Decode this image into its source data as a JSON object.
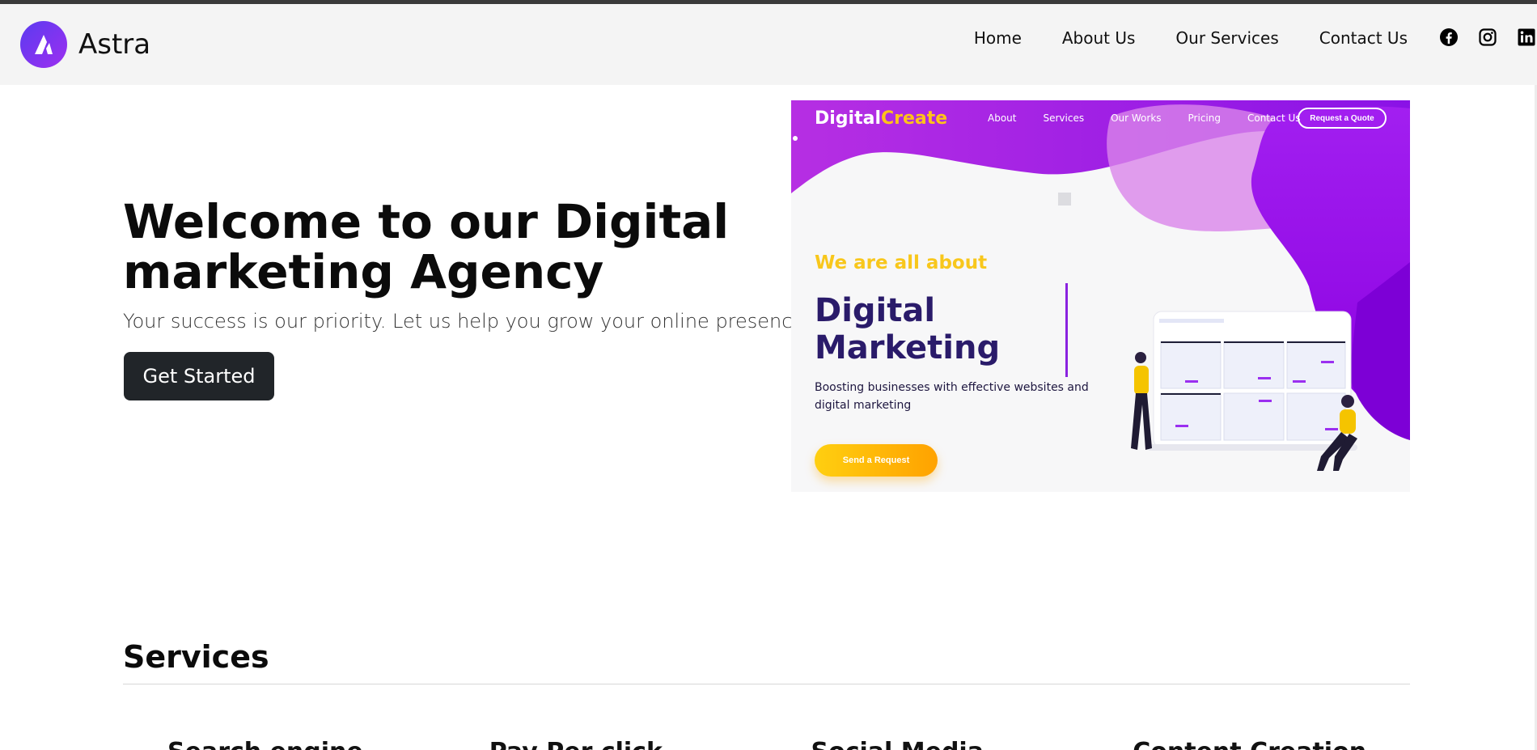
{
  "header": {
    "brand_name": "Astra",
    "nav": [
      "Home",
      "About Us",
      "Our Services",
      "Contact Us"
    ],
    "social_icons": [
      "facebook-icon",
      "instagram-icon",
      "linkedin-icon"
    ]
  },
  "hero": {
    "title": "Welcome to our Digital marketing Agency",
    "subtitle": "Your success is our priority. Let us help you grow your online presence.",
    "cta_label": "Get Started"
  },
  "hero_image": {
    "brand_main": "Digital",
    "brand_accent": "Create",
    "nav": [
      "About",
      "Services",
      "Our Works",
      "Pricing",
      "Contact Us"
    ],
    "quote_button": "Request a Quote",
    "tagline": "We are all about",
    "headline": "Digital Marketing",
    "description": "Boosting businesses with effective websites and digital marketing",
    "button": "Send a Request"
  },
  "services": {
    "title": "Services",
    "items": [
      "Search engine",
      "Pay Per click",
      "Social Media",
      "Content Creation"
    ]
  },
  "colors": {
    "header_bg": "#f4f4f4",
    "cta_bg": "#212529",
    "brand_gradient_start": "#5b3bf0",
    "brand_gradient_end": "#9d2ff0",
    "mock_purple": "#9b10e8",
    "mock_yellow": "#f8c71c",
    "mock_navy": "#2a1b6a"
  }
}
